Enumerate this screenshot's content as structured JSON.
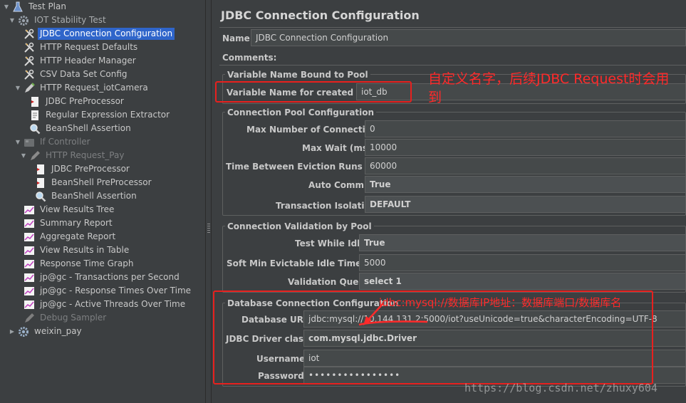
{
  "tree": {
    "items": [
      {
        "label": "Test Plan",
        "icon": "flask-icon"
      },
      {
        "label": "IOT Stability Test",
        "icon": "gear-icon"
      },
      {
        "label": "JDBC Connection Configuration",
        "icon": "wrench-icon"
      },
      {
        "label": "HTTP Request Defaults",
        "icon": "wrench-icon"
      },
      {
        "label": "HTTP Header Manager",
        "icon": "wrench-icon"
      },
      {
        "label": "CSV Data Set Config",
        "icon": "wrench-icon"
      },
      {
        "label": "HTTP Request_iotCamera",
        "icon": "pen-icon"
      },
      {
        "label": "JDBC PreProcessor",
        "icon": "preprocessor-icon"
      },
      {
        "label": "Regular Expression Extractor",
        "icon": "document-icon"
      },
      {
        "label": "BeanShell Assertion",
        "icon": "magnifier-icon"
      },
      {
        "label": "If Controller",
        "icon": "controller-icon"
      },
      {
        "label": "HTTP Request_Pay",
        "icon": "pen-icon"
      },
      {
        "label": "JDBC PreProcessor",
        "icon": "preprocessor-icon"
      },
      {
        "label": "BeanShell PreProcessor",
        "icon": "preprocessor-icon"
      },
      {
        "label": "BeanShell Assertion",
        "icon": "magnifier-icon"
      },
      {
        "label": "View Results Tree",
        "icon": "graph-icon"
      },
      {
        "label": "Summary Report",
        "icon": "graph-icon"
      },
      {
        "label": "Aggregate Report",
        "icon": "graph-icon"
      },
      {
        "label": "View Results in Table",
        "icon": "graph-icon"
      },
      {
        "label": "Response Time Graph",
        "icon": "graph-icon"
      },
      {
        "label": "jp@gc - Transactions per Second",
        "icon": "graph-icon"
      },
      {
        "label": "jp@gc - Response Times Over Time",
        "icon": "graph-icon"
      },
      {
        "label": "jp@gc - Active Threads Over Time",
        "icon": "graph-icon"
      },
      {
        "label": "Debug Sampler",
        "icon": "pen-icon"
      },
      {
        "label": "weixin_pay",
        "icon": "gear-icon"
      }
    ],
    "selected": "JDBC Connection Configuration"
  },
  "panel": {
    "title": "JDBC Connection Configuration",
    "name_label": "Name:",
    "name_value": "JDBC Connection Configuration",
    "comments_label": "Comments:",
    "var_group": {
      "legend": "Variable Name Bound to Pool",
      "label": "Variable Name for created pool:",
      "value": "iot_db"
    },
    "pool_group": {
      "legend": "Connection Pool Configuration",
      "max_conn_label": "Max Number of Connections:",
      "max_conn_value": "0",
      "max_wait_label": "Max Wait (ms):",
      "max_wait_value": "10000",
      "eviction_label": "Time Between Eviction Runs (ms):",
      "eviction_value": "60000",
      "autocommit_label": "Auto Commit:",
      "autocommit_value": "True",
      "isolation_label": "Transaction Isolation:",
      "isolation_value": "DEFAULT"
    },
    "validation_group": {
      "legend": "Connection Validation by Pool",
      "idle_label": "Test While Idle:",
      "idle_value": "True",
      "soft_min_label": "Soft Min Evictable Idle Time(ms):",
      "soft_min_value": "5000",
      "query_label": "Validation Query:",
      "query_value": "select 1"
    },
    "db_group": {
      "legend": "Database Connection Configuration",
      "url_label": "Database URL:",
      "url_value": "jdbc:mysql://10.144.131.2:5000/iot?useUnicode=true&characterEncoding=UTF-8",
      "driver_label": "JDBC Driver class:",
      "driver_value": "com.mysql.jdbc.Driver",
      "user_label": "Username:",
      "user_value": "iot",
      "pass_label": "Password:",
      "pass_value": "••••••••••••••••"
    }
  },
  "annotations": {
    "note1": "自定义名字，后续JDBC Request时会用到",
    "note2": "jdbc:mysql://数据库IP地址：数据库端口/数据库名",
    "color": "#ff2a2a"
  },
  "watermark": "https://blog.csdn.net/zhuxy604"
}
